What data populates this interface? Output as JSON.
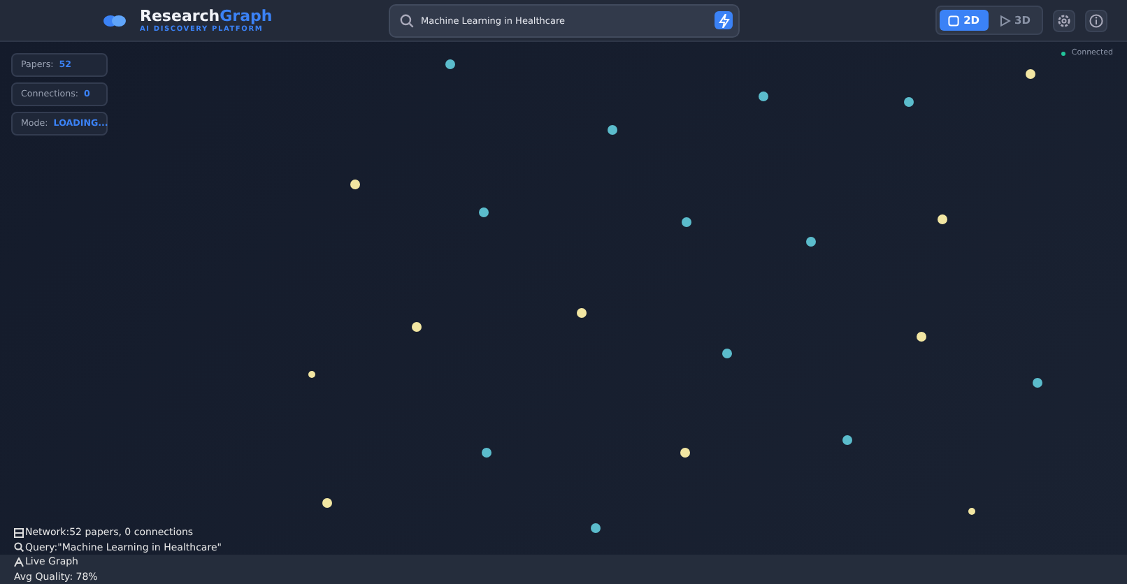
{
  "brand": {
    "name_plain": "Research",
    "name_accent": "Graph",
    "tagline": "AI DISCOVERY PLATFORM"
  },
  "search": {
    "value": "Machine Learning in Healthcare"
  },
  "view_modes": [
    {
      "label": "2D",
      "selected": true
    },
    {
      "label": "3D",
      "selected": false
    }
  ],
  "stats": [
    {
      "label": "Papers:",
      "value": "52"
    },
    {
      "label": "Connections:",
      "value": "0"
    },
    {
      "label": "Mode:",
      "value": "LOADING..."
    }
  ],
  "connection": {
    "label": "Connected",
    "color": "#22c59a"
  },
  "nodes": [
    {
      "color": "#5bbccc"
    },
    {
      "color": "#5bbccc"
    },
    {
      "color": "#5bbccc"
    },
    {
      "color": "#5bbccc"
    },
    {
      "color": "#5bbccc"
    },
    {
      "color": "#5bbccc"
    },
    {
      "color": "#5bbccc"
    },
    {
      "color": "#5bbccc"
    },
    {
      "color": "#5bbccc"
    },
    {
      "color": "#5bbccc"
    },
    {
      "color": "#5bbccc"
    },
    {
      "color": "#5bbccc"
    },
    {
      "color": "#f2e6a2"
    },
    {
      "color": "#f2e6a2"
    },
    {
      "color": "#f2e6a2"
    },
    {
      "color": "#f2e6a2"
    },
    {
      "color": "#f2e6a2"
    },
    {
      "color": "#f2e6a2"
    },
    {
      "color": "#f2e6a2"
    },
    {
      "color": "#f2e6a2"
    },
    {
      "color": "#f2e6a2"
    },
    {
      "color": "#f2e6a2"
    }
  ],
  "status_lines": [
    {
      "kind": "network",
      "text": "Network:52 papers, 0 connections"
    },
    {
      "kind": "query",
      "text": "Query:\"Machine Learning in Healthcare\""
    },
    {
      "kind": "live",
      "text": "Live Graph"
    },
    {
      "kind": "plain",
      "text": "Avg Quality: 78%"
    }
  ]
}
